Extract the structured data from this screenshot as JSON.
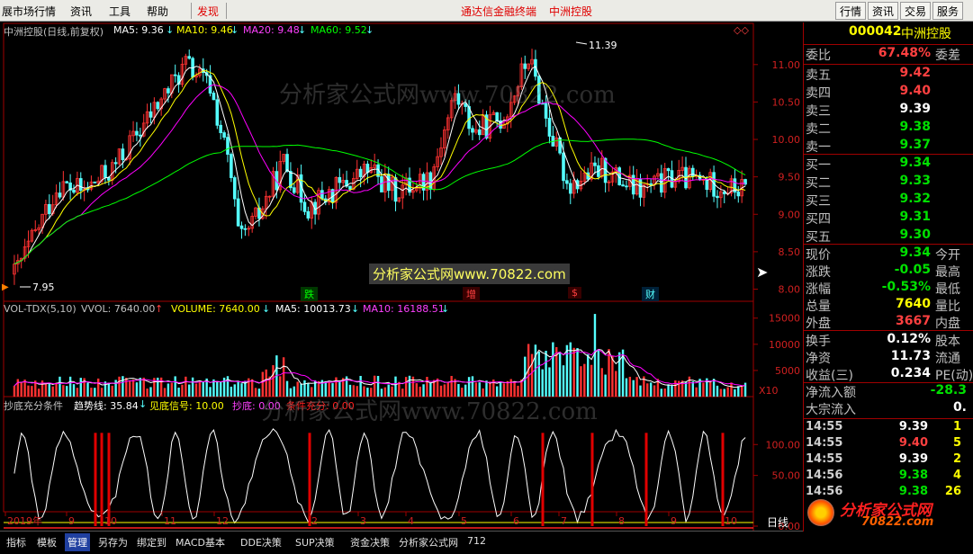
{
  "menubar": {
    "items": [
      "展市场行情",
      "资讯",
      "工具",
      "帮助"
    ],
    "discover": "发现",
    "center_text": "通达信金融终端",
    "center_stock": "中洲控股",
    "right_buttons": [
      "行情",
      "资讯",
      "交易",
      "服务"
    ]
  },
  "main_chart": {
    "title": "中洲控股(日线,前复权)",
    "ma5": "MA5: 9.36",
    "ma10": "MA10: 9.46",
    "ma20": "MA20: 9.48",
    "ma60": "MA60: 9.52",
    "high_label": "11.39",
    "low_label": "7.95",
    "y_ticks": [
      "11.00",
      "10.50",
      "10.00",
      "9.50",
      "9.00",
      "8.50",
      "8.00"
    ],
    "markers": [
      "跌",
      "增",
      "$",
      "财"
    ],
    "colors": {
      "ma5": "#ffffff",
      "ma10": "#ffff00",
      "ma20": "#ff00ff",
      "ma60": "#00ff00",
      "up": "#ff3232",
      "down": "#54ffff"
    }
  },
  "volume_chart": {
    "indicator": "VOL-TDX(5,10)",
    "vvol": "VVOL: 7640.00",
    "volume": "VOLUME: 7640.00",
    "ma5": "MA5: 10013.73",
    "ma10": "MA10: 16188.51",
    "y_ticks": [
      "15000",
      "10000",
      "5000"
    ],
    "unit": "X10"
  },
  "indicator_chart": {
    "name": "抄底充分条件",
    "trend": "趋势线: 35.84",
    "signal": "见底信号: 10.00",
    "bottom": "抄底: 0.00",
    "cond": "条件充分: 0.00",
    "y_ticks": [
      "100.00",
      "50.00",
      "0.00"
    ]
  },
  "date_axis": [
    "2019年",
    "9",
    "10",
    "11",
    "12",
    "2",
    "3",
    "4",
    "5",
    "6",
    "7",
    "8",
    "9",
    "10"
  ],
  "period": "日线",
  "watermark_main": "分析家公式网www.70822.com",
  "watermark_box": "分析家公式网www.70822.com",
  "watermark_ind": "分析家公式网www.70822.com",
  "logo": {
    "title": "分析家公式网",
    "url": "70822.com"
  },
  "quote": {
    "code": "000042",
    "name": "中洲控股",
    "weibi_label": "委比",
    "weibi": "67.48%",
    "weicha_label": "委差",
    "asks": [
      {
        "label": "卖五",
        "price": "9.42"
      },
      {
        "label": "卖四",
        "price": "9.40"
      },
      {
        "label": "卖三",
        "price": "9.39"
      },
      {
        "label": "卖二",
        "price": "9.38"
      },
      {
        "label": "卖一",
        "price": "9.37"
      }
    ],
    "bids": [
      {
        "label": "买一",
        "price": "9.34"
      },
      {
        "label": "买二",
        "price": "9.33"
      },
      {
        "label": "买三",
        "price": "9.32"
      },
      {
        "label": "买四",
        "price": "9.31"
      },
      {
        "label": "买五",
        "price": "9.30"
      }
    ],
    "stats": [
      {
        "label": "现价",
        "value": "9.34",
        "right": "今开"
      },
      {
        "label": "涨跌",
        "value": "-0.05",
        "right": "最高"
      },
      {
        "label": "涨幅",
        "value": "-0.53%",
        "right": "最低"
      },
      {
        "label": "总量",
        "value": "7640",
        "right": "量比"
      },
      {
        "label": "外盘",
        "value": "3667",
        "right": "内盘"
      }
    ],
    "stats2": [
      {
        "label": "换手",
        "value": "0.12%",
        "right": "股本"
      },
      {
        "label": "净资",
        "value": "11.73",
        "right": "流通"
      },
      {
        "label": "收益(三)",
        "value": "0.234",
        "right": "PE(动)"
      }
    ],
    "flow": [
      {
        "label": "净流入额",
        "value": "-28.3"
      },
      {
        "label": "大宗流入",
        "value": "0."
      }
    ],
    "trades": [
      {
        "time": "14:55",
        "price": "9.39",
        "qty": "1"
      },
      {
        "time": "14:55",
        "price": "9.40",
        "qty": "5"
      },
      {
        "time": "14:55",
        "price": "9.39",
        "qty": "2"
      },
      {
        "time": "14:56",
        "price": "9.38",
        "qty": "4"
      },
      {
        "time": "14:56",
        "price": "9.38",
        "qty": "26"
      }
    ]
  },
  "bottom_tabs": [
    "指标",
    "模板",
    "管理",
    "另存为",
    "绑定到",
    "MACD基本",
    "DDE决策",
    "SUP决策",
    "资金决策",
    "分析家公式网",
    "712"
  ]
}
